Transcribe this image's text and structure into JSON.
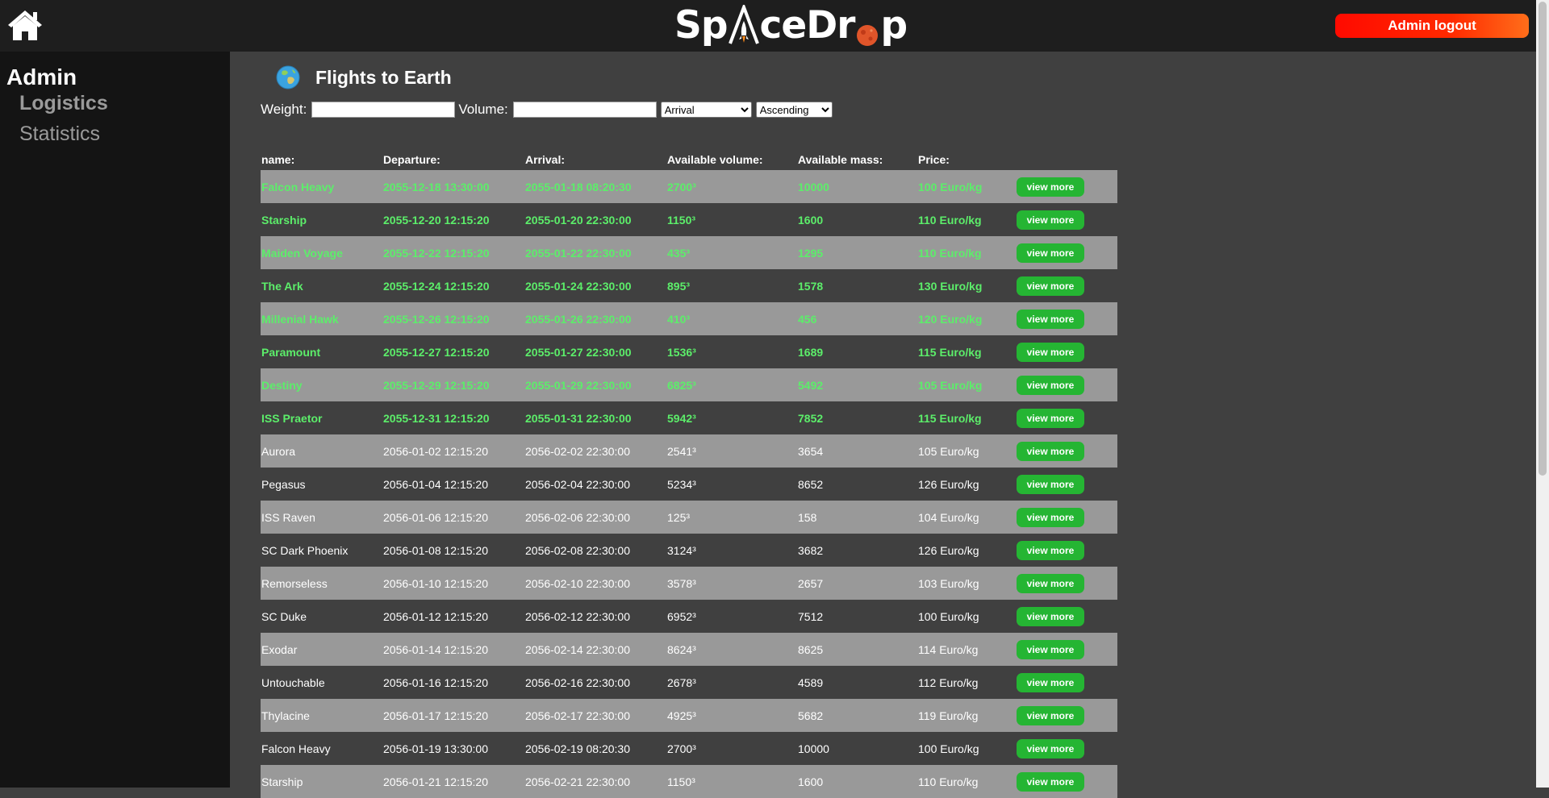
{
  "header": {
    "logo": {
      "part1": "Sp",
      "part2": "ceDr",
      "part3": "p"
    },
    "logout_label": "Admin logout"
  },
  "sidebar": {
    "heading": "Admin",
    "items": [
      {
        "label": "Logistics"
      },
      {
        "label": "Statistics"
      }
    ]
  },
  "main": {
    "title": "Flights to Earth",
    "filters": {
      "weight_label": "Weight:",
      "volume_label": "Volume:",
      "sort_field": "Arrival",
      "sort_order": "Ascending"
    },
    "columns": {
      "name": "name:",
      "departure": "Departure:",
      "arrival": "Arrival:",
      "volume": "Available volume:",
      "mass": "Available mass:",
      "price": "Price:"
    },
    "view_more_label": "view more",
    "rows": [
      {
        "name": "Falcon Heavy",
        "departure": "2055-12-18 13:30:00",
        "arrival": "2055-01-18 08:20:30",
        "volume": "2700³",
        "mass": "10000",
        "price": "100 Euro/kg",
        "highlighted": true
      },
      {
        "name": "Starship",
        "departure": "2055-12-20 12:15:20",
        "arrival": "2055-01-20 22:30:00",
        "volume": "1150³",
        "mass": "1600",
        "price": "110 Euro/kg",
        "highlighted": true
      },
      {
        "name": "Maiden Voyage",
        "departure": "2055-12-22 12:15:20",
        "arrival": "2055-01-22 22:30:00",
        "volume": "435³",
        "mass": "1295",
        "price": "110 Euro/kg",
        "highlighted": true
      },
      {
        "name": "The Ark",
        "departure": "2055-12-24 12:15:20",
        "arrival": "2055-01-24 22:30:00",
        "volume": "895³",
        "mass": "1578",
        "price": "130 Euro/kg",
        "highlighted": true
      },
      {
        "name": "Millenial Hawk",
        "departure": "2055-12-26 12:15:20",
        "arrival": "2055-01-26 22:30:00",
        "volume": "410³",
        "mass": "456",
        "price": "120 Euro/kg",
        "highlighted": true
      },
      {
        "name": "Paramount",
        "departure": "2055-12-27 12:15:20",
        "arrival": "2055-01-27 22:30:00",
        "volume": "1536³",
        "mass": "1689",
        "price": "115 Euro/kg",
        "highlighted": true
      },
      {
        "name": "Destiny",
        "departure": "2055-12-29 12:15:20",
        "arrival": "2055-01-29 22:30:00",
        "volume": "6825³",
        "mass": "5492",
        "price": "105 Euro/kg",
        "highlighted": true
      },
      {
        "name": "ISS Praetor",
        "departure": "2055-12-31 12:15:20",
        "arrival": "2055-01-31 22:30:00",
        "volume": "5942³",
        "mass": "7852",
        "price": "115 Euro/kg",
        "highlighted": true
      },
      {
        "name": "Aurora",
        "departure": "2056-01-02 12:15:20",
        "arrival": "2056-02-02 22:30:00",
        "volume": "2541³",
        "mass": "3654",
        "price": "105 Euro/kg",
        "highlighted": false
      },
      {
        "name": "Pegasus",
        "departure": "2056-01-04 12:15:20",
        "arrival": "2056-02-04 22:30:00",
        "volume": "5234³",
        "mass": "8652",
        "price": "126 Euro/kg",
        "highlighted": false
      },
      {
        "name": "ISS Raven",
        "departure": "2056-01-06 12:15:20",
        "arrival": "2056-02-06 22:30:00",
        "volume": "125³",
        "mass": "158",
        "price": "104 Euro/kg",
        "highlighted": false
      },
      {
        "name": "SC Dark Phoenix",
        "departure": "2056-01-08 12:15:20",
        "arrival": "2056-02-08 22:30:00",
        "volume": "3124³",
        "mass": "3682",
        "price": "126 Euro/kg",
        "highlighted": false
      },
      {
        "name": "Remorseless",
        "departure": "2056-01-10 12:15:20",
        "arrival": "2056-02-10 22:30:00",
        "volume": "3578³",
        "mass": "2657",
        "price": "103 Euro/kg",
        "highlighted": false
      },
      {
        "name": "SC Duke",
        "departure": "2056-01-12 12:15:20",
        "arrival": "2056-02-12 22:30:00",
        "volume": "6952³",
        "mass": "7512",
        "price": "100 Euro/kg",
        "highlighted": false
      },
      {
        "name": "Exodar",
        "departure": "2056-01-14 12:15:20",
        "arrival": "2056-02-14 22:30:00",
        "volume": "8624³",
        "mass": "8625",
        "price": "114 Euro/kg",
        "highlighted": false
      },
      {
        "name": "Untouchable",
        "departure": "2056-01-16 12:15:20",
        "arrival": "2056-02-16 22:30:00",
        "volume": "2678³",
        "mass": "4589",
        "price": "112 Euro/kg",
        "highlighted": false
      },
      {
        "name": "Thylacine",
        "departure": "2056-01-17 12:15:20",
        "arrival": "2056-02-17 22:30:00",
        "volume": "4925³",
        "mass": "5682",
        "price": "119 Euro/kg",
        "highlighted": false
      },
      {
        "name": "Falcon Heavy",
        "departure": "2056-01-19 13:30:00",
        "arrival": "2056-02-19 08:20:30",
        "volume": "2700³",
        "mass": "10000",
        "price": "100 Euro/kg",
        "highlighted": false
      },
      {
        "name": "Starship",
        "departure": "2056-01-21 12:15:20",
        "arrival": "2056-02-21 22:30:00",
        "volume": "1150³",
        "mass": "1600",
        "price": "110 Euro/kg",
        "highlighted": false
      }
    ]
  },
  "colors": {
    "highlight_text": "#5cee6a",
    "button_green": "#25b533",
    "logout_red": "#ff0a00",
    "striped_row": "#999999",
    "content_bg": "#404040"
  }
}
